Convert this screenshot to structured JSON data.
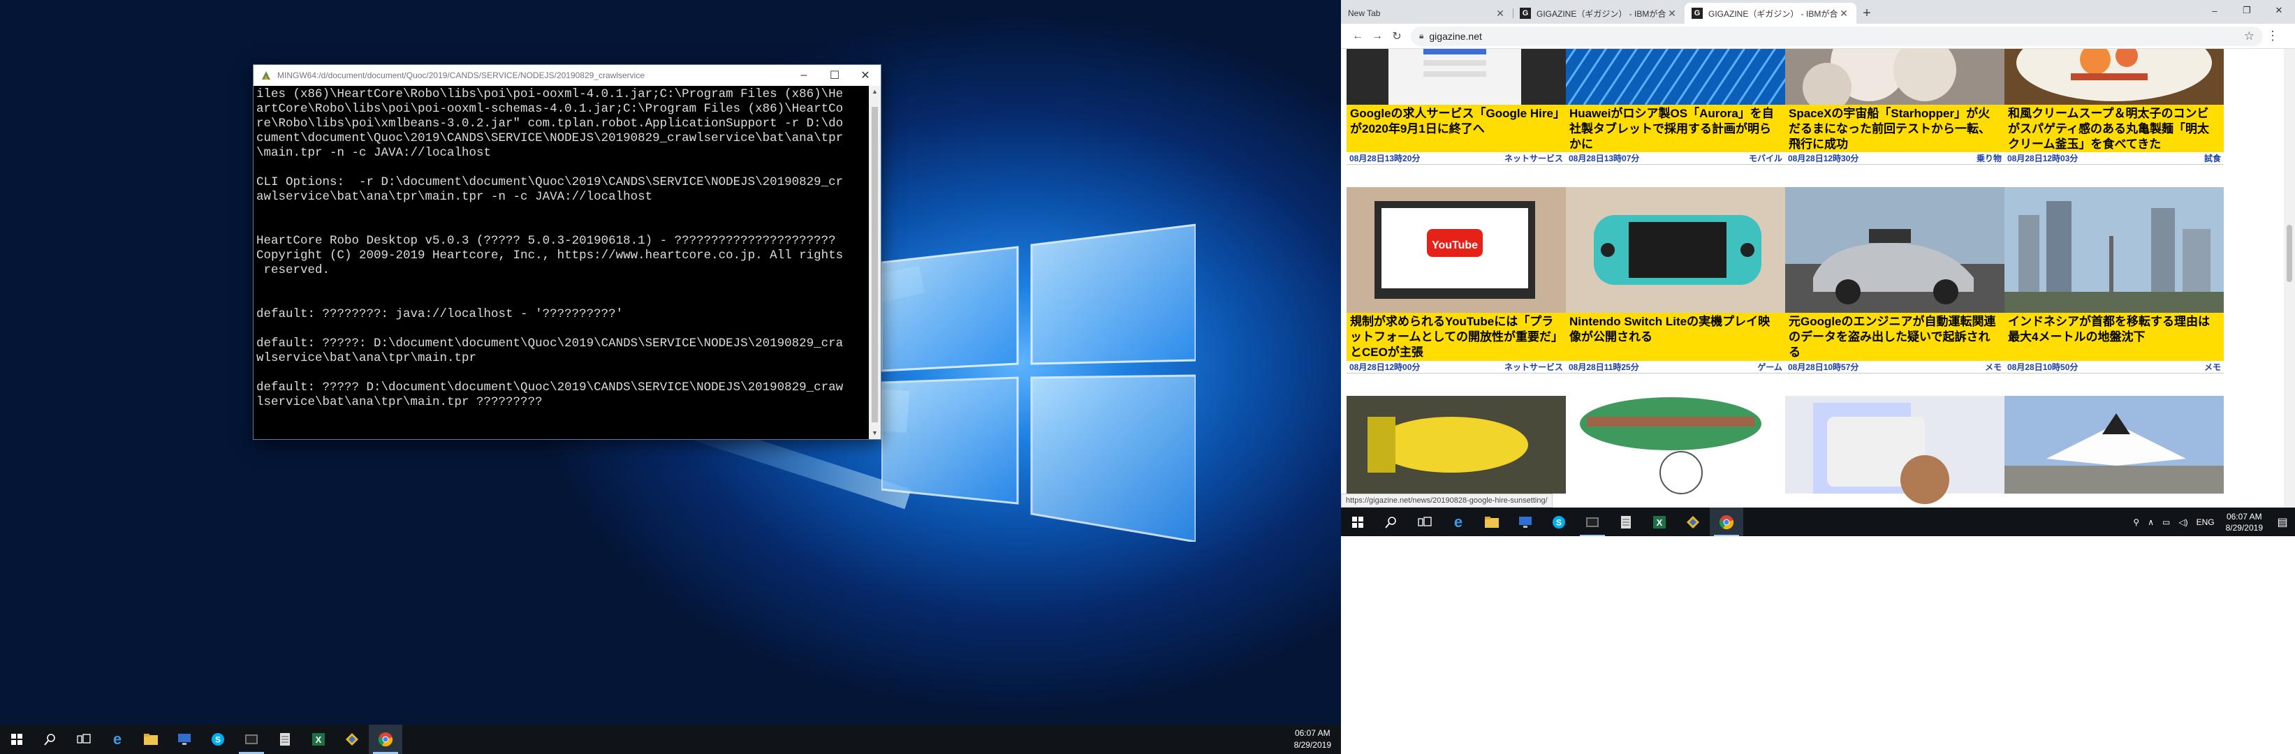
{
  "terminal": {
    "title": "MINGW64:/d/document/document/Quoc/2019/CANDS/SERVICE/NODEJS/20190829_crawlservice",
    "lines": [
      "iles (x86)\\HeartCore\\Robo\\libs\\poi\\poi-ooxml-4.0.1.jar;C:\\Program Files (x86)\\He",
      "artCore\\Robo\\libs\\poi\\poi-ooxml-schemas-4.0.1.jar;C:\\Program Files (x86)\\HeartCo",
      "re\\Robo\\libs\\poi\\xmlbeans-3.0.2.jar\" com.tplan.robot.ApplicationSupport -r D:\\do",
      "cument\\document\\Quoc\\2019\\CANDS\\SERVICE\\NODEJS\\20190829_crawlservice\\bat\\ana\\tpr",
      "\\main.tpr -n -c JAVA://localhost",
      "",
      "CLI Options:  -r D:\\document\\document\\Quoc\\2019\\CANDS\\SERVICE\\NODEJS\\20190829_cr",
      "awlservice\\bat\\ana\\tpr\\main.tpr -n -c JAVA://localhost",
      "",
      "",
      "HeartCore Robo Desktop v5.0.3 (????? 5.0.3-20190618.1) - ??????????????????????",
      "Copyright (C) 2009-2019 Heartcore, Inc., https://www.heartcore.co.jp. All rights",
      " reserved.",
      "",
      "",
      "default: ????????: java://localhost - '??????????'",
      "",
      "default: ?????: D:\\document\\document\\Quoc\\2019\\CANDS\\SERVICE\\NODEJS\\20190829_cra",
      "wlservice\\bat\\ana\\tpr\\main.tpr",
      "",
      "default: ????? D:\\document\\document\\Quoc\\2019\\CANDS\\SERVICE\\NODEJS\\20190829_craw",
      "lservice\\bat\\ana\\tpr\\main.tpr ?????????"
    ]
  },
  "left_taskbar": {
    "time": "06:07 AM",
    "date": "8/29/2019"
  },
  "browser": {
    "tabs": [
      {
        "label": "New Tab",
        "favicon": ""
      },
      {
        "label": "GIGAZINE（ギガジン） - IBMが合",
        "favicon": "G"
      },
      {
        "label": "GIGAZINE（ギガジン） - IBMが合",
        "favicon": "G"
      }
    ],
    "url": "gigazine.net",
    "status_url": "https://gigazine.net/news/20190828-google-hire-sunsetting/"
  },
  "articles": [
    {
      "title": "Googleの求人サービス「Google Hire」が2020年9月1日に終了へ",
      "date": "08月28日13時20分",
      "category": "ネットサービス",
      "img": "g1"
    },
    {
      "title": "Huaweiがロシア製OS「Aurora」を自社製タブレットで採用する計画が明らかに",
      "date": "08月28日13時07分",
      "category": "モバイル",
      "img": "g2"
    },
    {
      "title": "SpaceXの宇宙船「Starhopper」が火だるまになった前回テストから一転、飛行に成功",
      "date": "08月28日12時30分",
      "category": "乗り物",
      "img": "g3"
    },
    {
      "title": "和風クリームスープ＆明太子のコンビがスパゲティ感のある丸亀製麺「明太クリーム釜玉」を食べてきた",
      "date": "08月28日12時03分",
      "category": "試食",
      "img": "g4"
    },
    {
      "title": "規制が求められるYouTubeには「プラットフォームとしての開放性が重要だ」とCEOが主張",
      "date": "08月28日12時00分",
      "category": "ネットサービス",
      "img": "g5"
    },
    {
      "title": "Nintendo Switch Liteの実機プレイ映像が公開される",
      "date": "08月28日11時25分",
      "category": "ゲーム",
      "img": "g6"
    },
    {
      "title": "元Googleのエンジニアが自動運転関連のデータを盗み出した疑いで起訴される",
      "date": "08月28日10時57分",
      "category": "メモ",
      "img": "g7"
    },
    {
      "title": "インドネシアが首都を移転する理由は最大4メートルの地盤沈下",
      "date": "08月28日10時50分",
      "category": "メモ",
      "img": "g8"
    },
    {
      "title": "",
      "date": "",
      "category": "",
      "img": "g9"
    },
    {
      "title": "",
      "date": "",
      "category": "",
      "img": "g10"
    },
    {
      "title": "",
      "date": "",
      "category": "",
      "img": "g11"
    },
    {
      "title": "",
      "date": "",
      "category": "",
      "img": "g12"
    }
  ],
  "right_taskbar": {
    "lang": "ENG",
    "time": "06:07 AM",
    "date": "8/29/2019"
  },
  "icons": {
    "start": "windows-start-icon",
    "search": "search-icon",
    "taskview": "task-view-icon"
  },
  "colors": {
    "caption_bg": "#ffdd00",
    "meta_text": "#1d3fa6",
    "taskbar": "#101318"
  }
}
